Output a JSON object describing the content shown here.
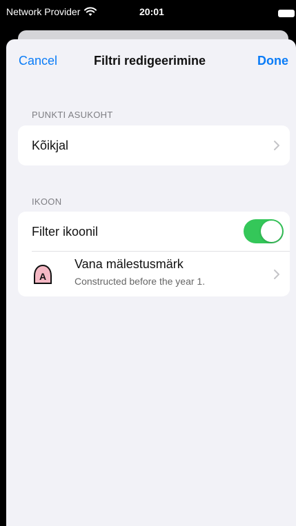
{
  "status_bar": {
    "carrier": "Network Provider",
    "time": "20:01"
  },
  "nav": {
    "cancel_label": "Cancel",
    "title": "Filtri redigeerimine",
    "done_label": "Done"
  },
  "sections": {
    "location": {
      "header": "PUNKTI ASUKOHT",
      "value": "Kõikjal"
    },
    "icon": {
      "header": "IKOON",
      "toggle_label": "Filter ikoonil",
      "toggle_on": true,
      "item_title": "Vana mälestusmärk",
      "item_subtitle": "Constructed before the year 1.",
      "item_icon_letter": "A"
    }
  },
  "colors": {
    "accent": "#0a7cf7",
    "toggle_on": "#34c759",
    "icon_fill": "#f4b8c4"
  },
  "icons": {
    "wifi": "wifi-icon",
    "battery": "battery-icon",
    "chevron": "chevron-right-icon",
    "item": "monument-a-icon"
  }
}
